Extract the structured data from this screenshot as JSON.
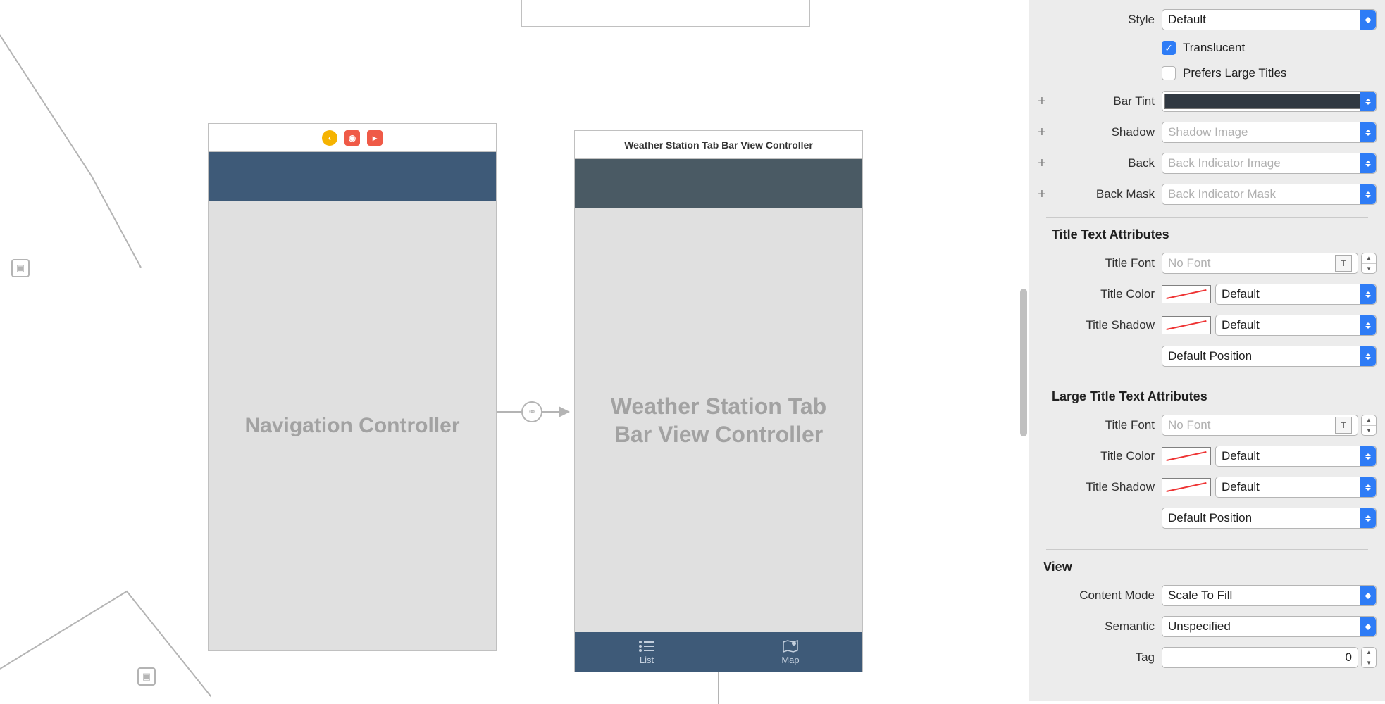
{
  "canvas": {
    "nav_scene": {
      "title_placeholder": "Navigation Controller"
    },
    "tabbar_scene": {
      "header_title": "Weather Station Tab Bar View Controller",
      "body_title": "Weather Station Tab Bar View Controller",
      "tabs": [
        {
          "label": "List"
        },
        {
          "label": "Map"
        }
      ]
    }
  },
  "inspector": {
    "navbar": {
      "style_label": "Style",
      "style_value": "Default",
      "translucent_label": "Translucent",
      "prefers_large_label": "Prefers Large Titles",
      "bar_tint_label": "Bar Tint",
      "shadow_label": "Shadow",
      "shadow_placeholder": "Shadow Image",
      "back_label": "Back",
      "back_placeholder": "Back Indicator Image",
      "back_mask_label": "Back Mask",
      "back_mask_placeholder": "Back Indicator Mask"
    },
    "title_attrs": {
      "section": "Title Text Attributes",
      "font_label": "Title Font",
      "font_placeholder": "No Font",
      "color_label": "Title Color",
      "color_value": "Default",
      "shadow_label": "Title Shadow",
      "shadow_value": "Default",
      "position_value": "Default Position"
    },
    "large_title_attrs": {
      "section": "Large Title Text Attributes",
      "font_label": "Title Font",
      "font_placeholder": "No Font",
      "color_label": "Title Color",
      "color_value": "Default",
      "shadow_label": "Title Shadow",
      "shadow_value": "Default",
      "position_value": "Default Position"
    },
    "view": {
      "section": "View",
      "content_mode_label": "Content Mode",
      "content_mode_value": "Scale To Fill",
      "semantic_label": "Semantic",
      "semantic_value": "Unspecified",
      "tag_label": "Tag",
      "tag_value": "0"
    }
  }
}
